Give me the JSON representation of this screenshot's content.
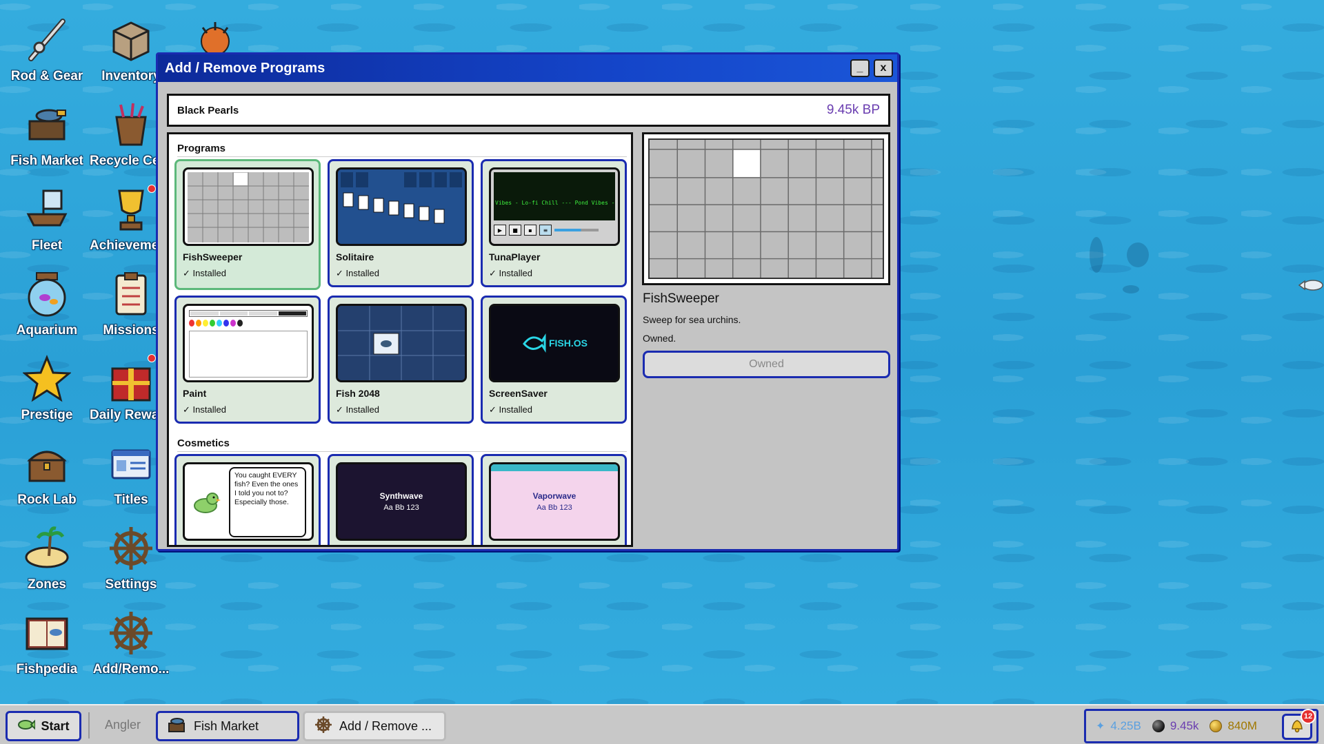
{
  "desktop": {
    "icons": [
      {
        "label": "Rod & Gear",
        "icon": "fishing-rod-icon"
      },
      {
        "label": "Inventory",
        "icon": "crate-icon"
      },
      {
        "label": "Fish Market",
        "icon": "fish-market-icon"
      },
      {
        "label": "Recycle Center",
        "icon": "bucket-icon"
      },
      {
        "label": "Fleet",
        "icon": "boat-icon"
      },
      {
        "label": "Achievements",
        "icon": "trophy-icon"
      },
      {
        "label": "Aquarium",
        "icon": "aquarium-icon"
      },
      {
        "label": "Missions",
        "icon": "clipboard-icon"
      },
      {
        "label": "Prestige",
        "icon": "star-icon"
      },
      {
        "label": "Daily Rewards",
        "icon": "gift-icon"
      },
      {
        "label": "Rock Lab",
        "icon": "treasure-chest-icon"
      },
      {
        "label": "Titles",
        "icon": "id-card-icon"
      },
      {
        "label": "Zones",
        "icon": "island-icon"
      },
      {
        "label": "Settings",
        "icon": "ship-wheel-icon"
      },
      {
        "label": "Fishpedia",
        "icon": "book-icon"
      },
      {
        "label": "Add/Remo...",
        "icon": "ship-wheel-icon"
      }
    ]
  },
  "window": {
    "title": "Add / Remove Programs",
    "minimize": "_",
    "close": "x",
    "currency_label": "Black Pearls",
    "currency_value": "9.45k BP",
    "sections": {
      "programs": "Programs",
      "cosmetics": "Cosmetics"
    },
    "programs": [
      {
        "name": "FishSweeper",
        "status": "✓ Installed",
        "selected": true
      },
      {
        "name": "Solitaire",
        "status": "✓ Installed"
      },
      {
        "name": "TunaPlayer",
        "status": "✓ Installed",
        "ticker": "Vibes - Lo-fi Chill --- Pond Vibes -"
      },
      {
        "name": "Paint",
        "status": "✓ Installed"
      },
      {
        "name": "Fish 2048",
        "status": "✓ Installed"
      },
      {
        "name": "ScreenSaver",
        "status": "✓ Installed",
        "logo": "FISH.OS"
      }
    ],
    "cosmetics": [
      {
        "speech": "You caught EVERY fish? Even the ones I told you not to? Especially those."
      },
      {
        "name": "Synthwave",
        "sample": "Aa Bb 123"
      },
      {
        "name": "Vaporwave",
        "sample": "Aa Bb 123"
      }
    ],
    "detail": {
      "name": "FishSweeper",
      "description": "Sweep for sea urchins.",
      "owned_text": "Owned.",
      "button": "Owned"
    }
  },
  "taskbar": {
    "start": "Start",
    "user": "Angler",
    "tasks": [
      {
        "label": "Fish Market",
        "icon": "fish-market-icon"
      },
      {
        "label": "Add / Remove ...",
        "icon": "ship-wheel-icon"
      }
    ],
    "tray": {
      "fish": "4.25B",
      "pearls": "9.45k",
      "coins": "840M",
      "notifications": "12"
    },
    "colors": {
      "fish": "#5aa0e0",
      "pearls": "#6a3db0",
      "coins": "#a07800"
    }
  }
}
